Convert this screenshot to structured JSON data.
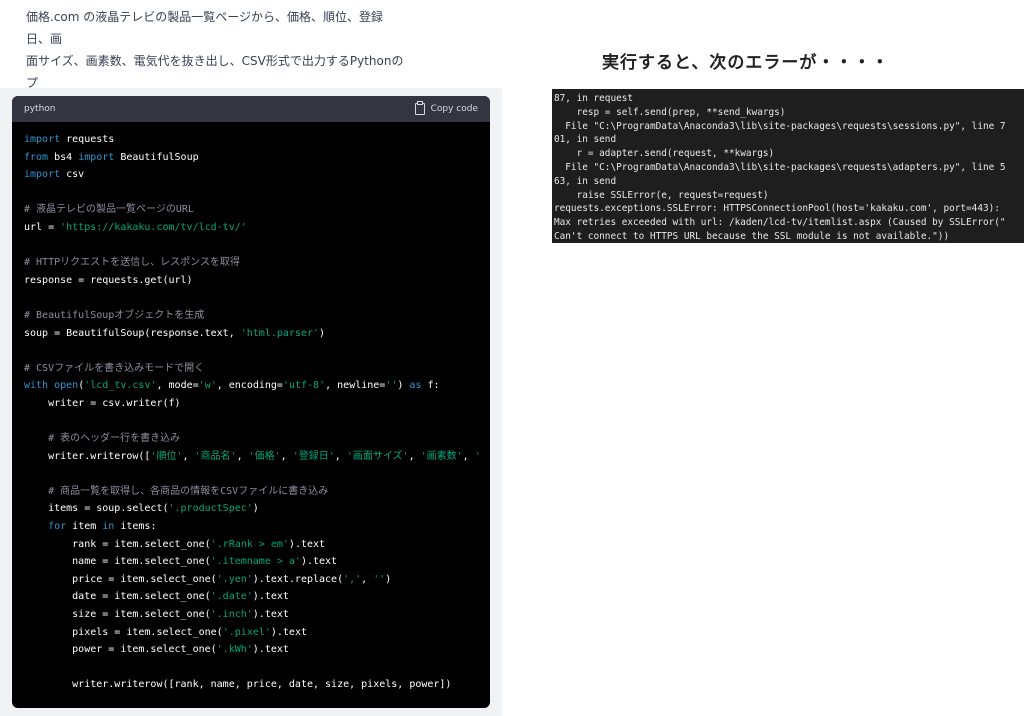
{
  "prompt_text": "価格.com の液晶テレビの製品一覧ページから、価格、順位、登録日、画\n面サイズ、画素数、電気代を抜き出し、CSV形式で出力するPythonのプ\nログラムを作成して",
  "codebox": {
    "language": "python",
    "copy_label": "Copy code",
    "icon": "clipboard-icon",
    "lines": [
      [
        {
          "t": "import",
          "c": "kw"
        },
        {
          "t": " requests"
        }
      ],
      [
        {
          "t": "from",
          "c": "kw"
        },
        {
          "t": " bs4 "
        },
        {
          "t": "import",
          "c": "kw"
        },
        {
          "t": " BeautifulSoup"
        }
      ],
      [
        {
          "t": "import",
          "c": "kw"
        },
        {
          "t": " csv"
        }
      ],
      [],
      [
        {
          "t": "# 液晶テレビの製品一覧ページのURL",
          "c": "com"
        }
      ],
      [
        {
          "t": "url = "
        },
        {
          "t": "'https://kakaku.com/tv/lcd-tv/'",
          "c": "str"
        }
      ],
      [],
      [
        {
          "t": "# HTTPリクエストを送信し、レスポンスを取得",
          "c": "com"
        }
      ],
      [
        {
          "t": "response = requests.get(url)"
        }
      ],
      [],
      [
        {
          "t": "# BeautifulSoupオブジェクトを生成",
          "c": "com"
        }
      ],
      [
        {
          "t": "soup = BeautifulSoup(response.text, "
        },
        {
          "t": "'html.parser'",
          "c": "str"
        },
        {
          "t": ")"
        }
      ],
      [],
      [
        {
          "t": "# CSVファイルを書き込みモードで開く",
          "c": "com"
        }
      ],
      [
        {
          "t": "with",
          "c": "kw"
        },
        {
          "t": " "
        },
        {
          "t": "open",
          "c": "kw"
        },
        {
          "t": "("
        },
        {
          "t": "'lcd_tv.csv'",
          "c": "str"
        },
        {
          "t": ", mode="
        },
        {
          "t": "'w'",
          "c": "str"
        },
        {
          "t": ", encoding="
        },
        {
          "t": "'utf-8'",
          "c": "str"
        },
        {
          "t": ", newline="
        },
        {
          "t": "''",
          "c": "str"
        },
        {
          "t": ") "
        },
        {
          "t": "as",
          "c": "kw"
        },
        {
          "t": " f:"
        }
      ],
      [
        {
          "t": "    writer = csv.writer(f)"
        }
      ],
      [],
      [
        {
          "t": "    "
        },
        {
          "t": "# 表のヘッダー行を書き込み",
          "c": "com"
        }
      ],
      [
        {
          "t": "    writer.writerow(["
        },
        {
          "t": "'順位'",
          "c": "str"
        },
        {
          "t": ", "
        },
        {
          "t": "'商品名'",
          "c": "str"
        },
        {
          "t": ", "
        },
        {
          "t": "'価格'",
          "c": "str"
        },
        {
          "t": ", "
        },
        {
          "t": "'登録日'",
          "c": "str"
        },
        {
          "t": ", "
        },
        {
          "t": "'画面サイズ'",
          "c": "str"
        },
        {
          "t": ", "
        },
        {
          "t": "'画素数'",
          "c": "str"
        },
        {
          "t": ", "
        },
        {
          "t": "'",
          "c": "str"
        }
      ],
      [],
      [
        {
          "t": "    "
        },
        {
          "t": "# 商品一覧を取得し、各商品の情報をCSVファイルに書き込み",
          "c": "com"
        }
      ],
      [
        {
          "t": "    items = soup.select("
        },
        {
          "t": "'.productSpec'",
          "c": "str"
        },
        {
          "t": ")"
        }
      ],
      [
        {
          "t": "    "
        },
        {
          "t": "for",
          "c": "kw"
        },
        {
          "t": " item "
        },
        {
          "t": "in",
          "c": "kw"
        },
        {
          "t": " items:"
        }
      ],
      [
        {
          "t": "        rank = item.select_one("
        },
        {
          "t": "'.rRank > em'",
          "c": "str"
        },
        {
          "t": ").text"
        }
      ],
      [
        {
          "t": "        name = item.select_one("
        },
        {
          "t": "'.itemname > a'",
          "c": "str"
        },
        {
          "t": ").text"
        }
      ],
      [
        {
          "t": "        price = item.select_one("
        },
        {
          "t": "'.yen'",
          "c": "str"
        },
        {
          "t": ").text.replace("
        },
        {
          "t": "','",
          "c": "str"
        },
        {
          "t": ", "
        },
        {
          "t": "''",
          "c": "str"
        },
        {
          "t": ")"
        }
      ],
      [
        {
          "t": "        date = item.select_one("
        },
        {
          "t": "'.date'",
          "c": "str"
        },
        {
          "t": ").text"
        }
      ],
      [
        {
          "t": "        size = item.select_one("
        },
        {
          "t": "'.inch'",
          "c": "str"
        },
        {
          "t": ").text"
        }
      ],
      [
        {
          "t": "        pixels = item.select_one("
        },
        {
          "t": "'.pixel'",
          "c": "str"
        },
        {
          "t": ").text"
        }
      ],
      [
        {
          "t": "        power = item.select_one("
        },
        {
          "t": "'.kWh'",
          "c": "str"
        },
        {
          "t": ").text"
        }
      ],
      [],
      [
        {
          "t": "        writer.writerow([rank, name, price, date, size, pixels, power])"
        }
      ]
    ]
  },
  "heading_text": "実行すると、次のエラーが・・・・",
  "terminal_text": "87, in request\n    resp = self.send(prep, **send_kwargs)\n  File \"C:\\ProgramData\\Anaconda3\\lib\\site-packages\\requests\\sessions.py\", line 7\n01, in send\n    r = adapter.send(request, **kwargs)\n  File \"C:\\ProgramData\\Anaconda3\\lib\\site-packages\\requests\\adapters.py\", line 5\n63, in send\n    raise SSLError(e, request=request)\nrequests.exceptions.SSLError: HTTPSConnectionPool(host='kakaku.com', port=443):\nMax retries exceeded with url: /kaden/lcd-tv/itemlist.aspx (Caused by SSLError(\"\nCan't connect to HTTPS URL because the SSL module is not available.\"))"
}
